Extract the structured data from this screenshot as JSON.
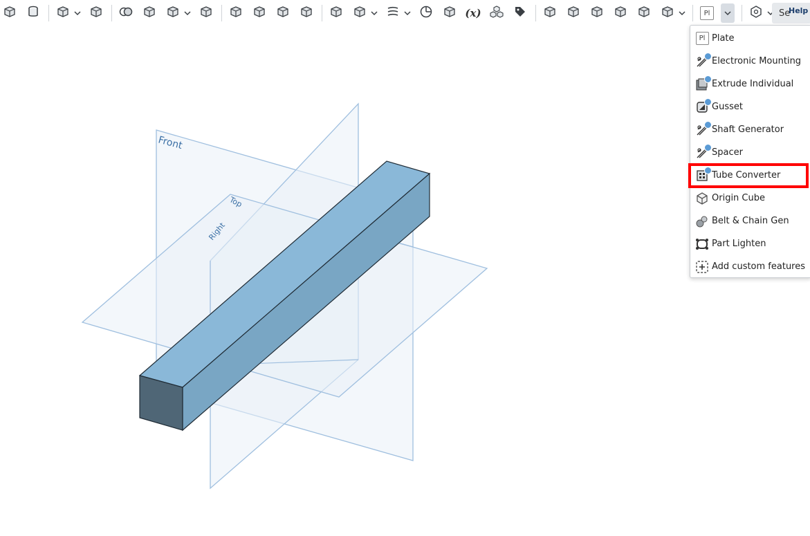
{
  "toolbar": {
    "items": [
      {
        "icon": "revolve-icon"
      },
      {
        "icon": "cylinder-icon"
      },
      {
        "sep": true
      },
      {
        "icon": "pattern-icon",
        "caret": true
      },
      {
        "icon": "mirror-icon"
      },
      {
        "sep": true
      },
      {
        "icon": "boolean-icon"
      },
      {
        "icon": "split-icon"
      },
      {
        "icon": "transform-icon",
        "caret": true
      },
      {
        "icon": "delete-part-icon"
      },
      {
        "sep": true
      },
      {
        "icon": "modify-fillet-icon"
      },
      {
        "icon": "delete-face-icon"
      },
      {
        "icon": "move-face-icon"
      },
      {
        "icon": "replace-face-icon"
      },
      {
        "sep": true
      },
      {
        "icon": "plane-icon"
      },
      {
        "icon": "mate-connector-icon",
        "caret": true
      },
      {
        "icon": "helix-icon",
        "caret": true
      },
      {
        "icon": "measure-icon"
      },
      {
        "icon": "import-icon"
      },
      {
        "icon": "variable-icon",
        "fx": "(x)"
      },
      {
        "icon": "cubes-icon"
      },
      {
        "icon": "tag-icon"
      },
      {
        "sep": true
      },
      {
        "icon": "sheet-metal-icon"
      },
      {
        "icon": "sheet-metal-close-icon"
      },
      {
        "icon": "flange-icon"
      },
      {
        "icon": "corner-icon"
      },
      {
        "icon": "table-icon"
      },
      {
        "icon": "flat-view-icon",
        "caret": true
      },
      {
        "sep": true
      },
      {
        "icon": "plate-icon",
        "pl": "Pl"
      },
      {
        "pressed": true
      },
      {
        "sep": true
      },
      {
        "icon": "custom-feature-icon",
        "caret": true
      }
    ],
    "search_stub": "Se",
    "help": "Help"
  },
  "viewport": {
    "planes": {
      "front": "Front",
      "top": "Top",
      "right": "Right"
    }
  },
  "menu": {
    "items": [
      {
        "label": "Plate",
        "icon": "plate-icon",
        "badge": false
      },
      {
        "label": "Electronic Mounting",
        "icon": "electronic-mounting-icon",
        "badge": true
      },
      {
        "label": "Extrude Individual",
        "icon": "extrude-individual-icon",
        "badge": true
      },
      {
        "label": "Gusset",
        "icon": "gusset-icon",
        "badge": true
      },
      {
        "label": "Shaft Generator",
        "icon": "shaft-generator-icon",
        "badge": true
      },
      {
        "label": "Spacer",
        "icon": "spacer-icon",
        "badge": true
      },
      {
        "label": "Tube Converter",
        "icon": "tube-converter-icon",
        "badge": true
      },
      {
        "label": "Origin Cube",
        "icon": "origin-cube-icon",
        "badge": false
      },
      {
        "label": "Belt & Chain Gen",
        "icon": "belt-chain-icon",
        "badge": false
      },
      {
        "label": "Part Lighten",
        "icon": "part-lighten-icon",
        "badge": false
      },
      {
        "label": "Add custom features",
        "icon": "add-custom-icon",
        "badge": false
      }
    ],
    "highlighted": "Tube Converter"
  },
  "colors": {
    "accent_highlight": "#ff0000",
    "badge": "#5b9bd5",
    "plane_stroke": "#8fb3d6"
  }
}
